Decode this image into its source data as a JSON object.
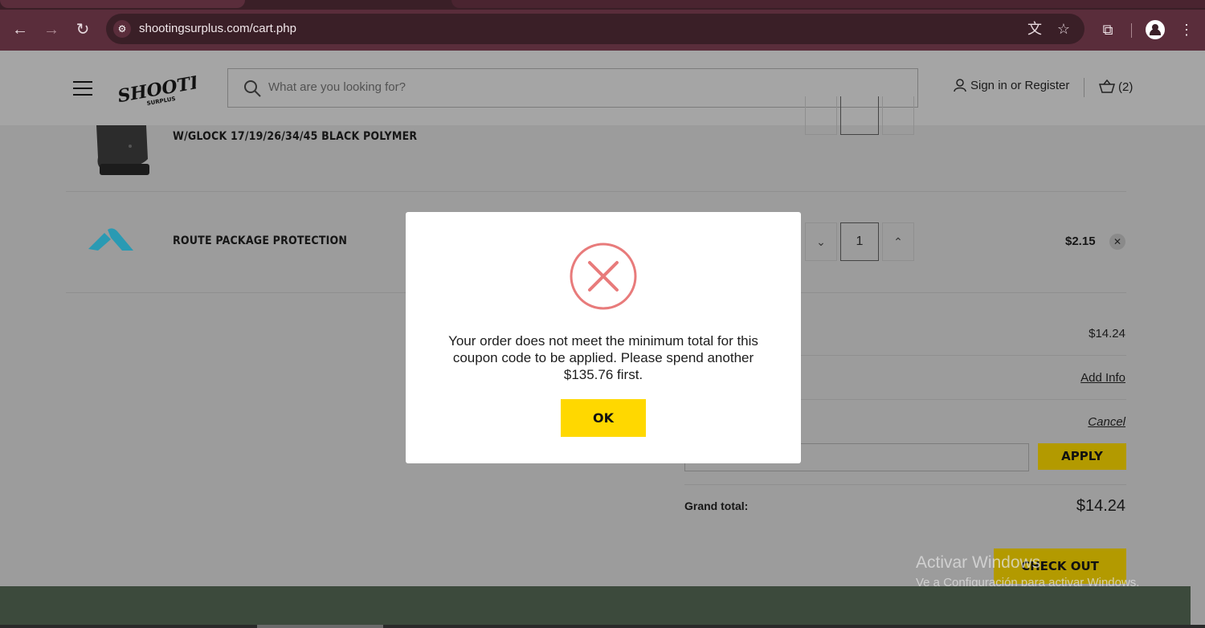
{
  "browser": {
    "url": "shootingsurplus.com/cart.php"
  },
  "header": {
    "logo_text": "SHOOTING",
    "logo_subtext": "SURPLUS",
    "search_placeholder": "What are you looking for?",
    "signin_label": "Sign in or Register",
    "cart_count": "(2)"
  },
  "cart": {
    "items": [
      {
        "name": "W/GLOCK 17/19/26/34/45 BLACK POLYMER"
      },
      {
        "name": "ROUTE PACKAGE PROTECTION",
        "quantity": "1",
        "price": "$2.15"
      }
    ]
  },
  "summary": {
    "subtotal": "$14.24",
    "shipping_link": "Add Info",
    "coupon_cancel": "Cancel",
    "apply_label": "APPLY",
    "grand_total_label": "Grand total:",
    "grand_total": "$14.24",
    "checkout_label": "CHECK OUT"
  },
  "modal": {
    "message": "Your order does not meet the minimum total for this coupon code to be applied. Please spend another $135.76 first.",
    "ok_label": "OK",
    "icon": "error-x-circle",
    "icon_color": "#e87b7b",
    "button_color": "#ffd800"
  },
  "watermark": {
    "line1": "Activar Windows",
    "line2": "Ve a Configuración para activar Windows."
  },
  "colors": {
    "browser_frame": "#5a2d3b",
    "accent_yellow": "#ffd800",
    "footer": "#3c4a3c"
  }
}
